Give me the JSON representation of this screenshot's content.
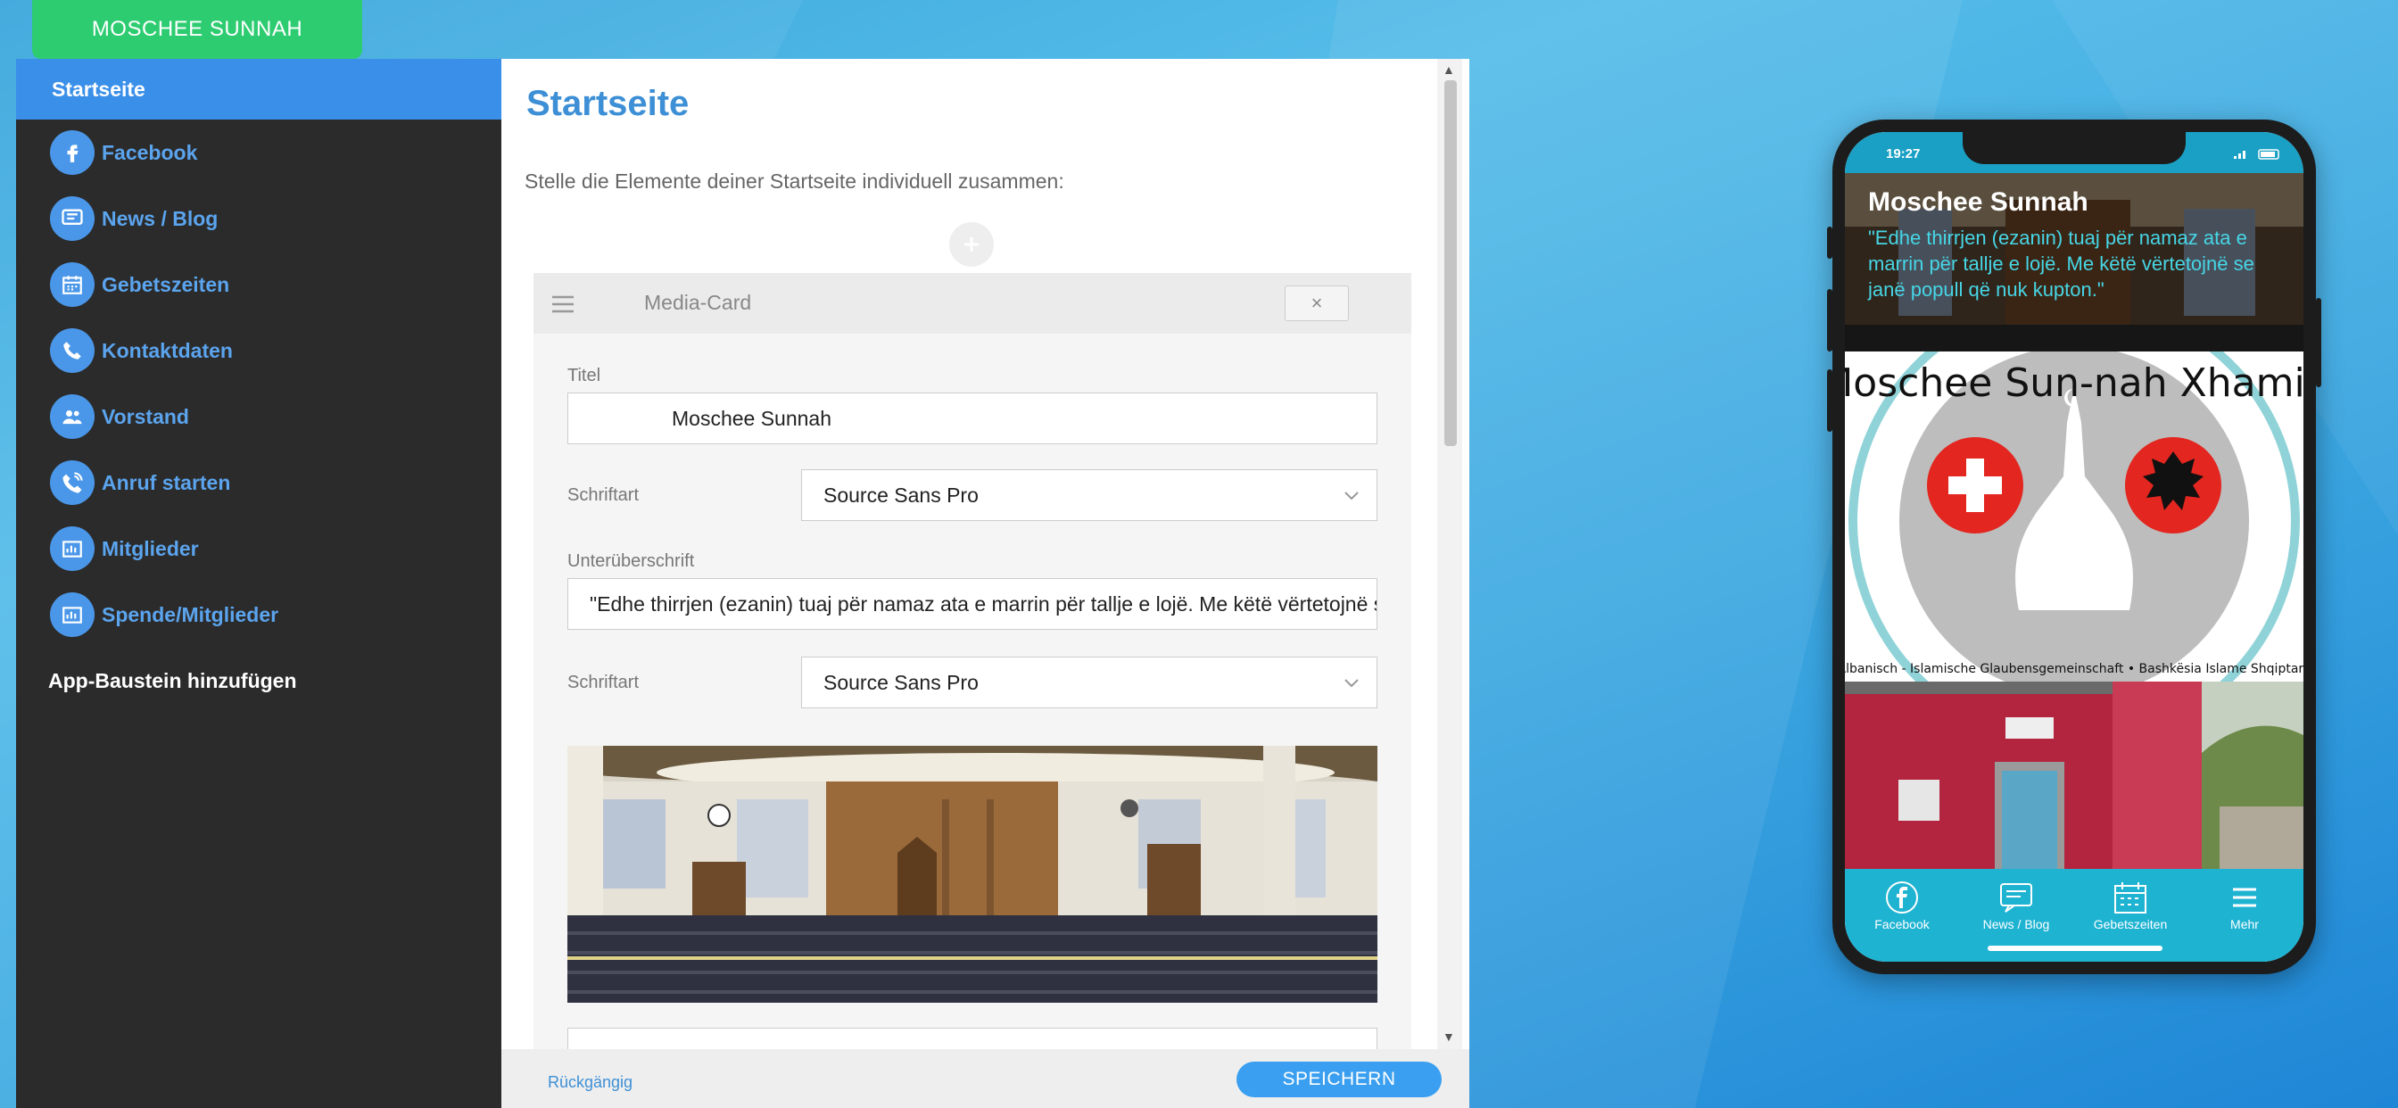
{
  "app_tab": "MOSCHEE SUNNAH",
  "sidebar": {
    "items": [
      {
        "label": "Startseite",
        "icon": "none"
      },
      {
        "label": "Facebook",
        "icon": "facebook-icon"
      },
      {
        "label": "News / Blog",
        "icon": "chat-icon"
      },
      {
        "label": "Gebetszeiten",
        "icon": "calendar-icon"
      },
      {
        "label": "Kontaktdaten",
        "icon": "phone-icon"
      },
      {
        "label": "Vorstand",
        "icon": "users-icon"
      },
      {
        "label": "Anruf starten",
        "icon": "phone-call-icon"
      },
      {
        "label": "Mitglieder",
        "icon": "members-icon"
      },
      {
        "label": "Spende/Mitglieder",
        "icon": "donate-icon"
      }
    ],
    "add_label": "App-Baustein hinzufügen"
  },
  "panel": {
    "title": "Startseite",
    "subtitle": "Stelle die Elemente deiner Startseite individuell zusammen:",
    "card": {
      "name": "Media-Card",
      "close": "×",
      "title_label": "Titel",
      "title_value": "Moschee Sunnah",
      "font_label_1": "Schriftart",
      "font_value_1": "Source Sans Pro",
      "subtitle_label": "Unterüberschrift",
      "subtitle_value": "\"Edhe thirrjen (ezanin) tuaj për namaz ata e marrin për tallje e lojë. Me këtë vërtetojnë se janë popull që nuk kupton.\"",
      "font_label_2": "Schriftart",
      "font_value_2": "Source Sans Pro"
    },
    "footer": {
      "undo": "Rückgängig",
      "save": "SPEICHERN"
    }
  },
  "phone": {
    "time": "19:27",
    "hero_title": "Moschee Sunnah",
    "hero_subtitle": "\"Edhe thirrjen (ezanin) tuaj për namaz ata e marrin për tallje e lojë. Me këtë vërtetojnë se janë popull që nuk kupton.\"",
    "logo_text_top": "Moschee Sun-nah Xhamia",
    "logo_text_bottom": "Albanisch - Islamische Glaubensgemeinschaft • Bashkësia Islame Shqiptare",
    "tabs": [
      {
        "label": "Facebook",
        "icon": "facebook-icon"
      },
      {
        "label": "News / Blog",
        "icon": "chat-icon"
      },
      {
        "label": "Gebetszeiten",
        "icon": "calendar-icon"
      },
      {
        "label": "Mehr",
        "icon": "menu-icon"
      }
    ]
  },
  "colors": {
    "accent": "#3a8fe8",
    "green_tab": "#2ecc71",
    "sidebar_bg": "#2b2b2b",
    "phone_tabbar": "#1fb3d2"
  }
}
